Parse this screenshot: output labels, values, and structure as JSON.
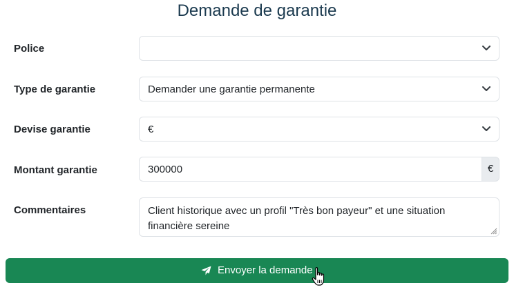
{
  "page": {
    "title": "Demande de garantie"
  },
  "form": {
    "police": {
      "label": "Police",
      "value": ""
    },
    "type_garantie": {
      "label": "Type de garantie",
      "value": "Demander une garantie permanente"
    },
    "devise": {
      "label": "Devise garantie",
      "value": "€"
    },
    "montant": {
      "label": "Montant garantie",
      "value": "300000",
      "addon": "€"
    },
    "commentaires": {
      "label": "Commentaires",
      "value": "Client historique avec un profil \"Très bon payeur\" et une situation financière sereine"
    },
    "submit": {
      "label": "Envoyer la demande",
      "icon": "paper-plane-icon",
      "color": "#198754"
    }
  }
}
